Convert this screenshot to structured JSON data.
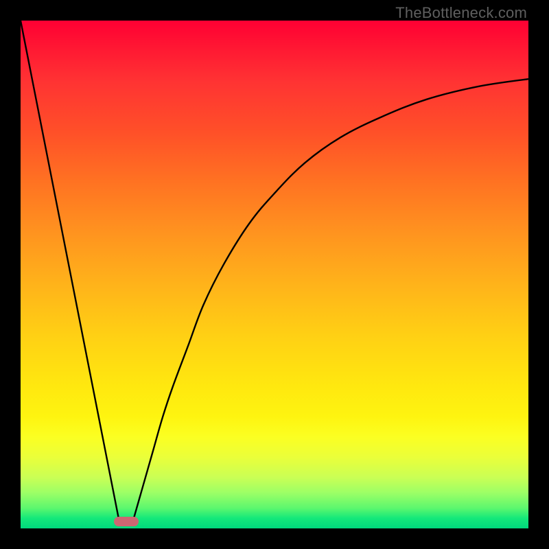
{
  "watermark": "TheBottleneck.com",
  "chart_data": {
    "type": "line",
    "title": "",
    "xlabel": "",
    "ylabel": "",
    "xlim": [
      0,
      100
    ],
    "ylim": [
      0,
      100
    ],
    "grid": false,
    "legend": false,
    "series": [
      {
        "name": "left-linear",
        "x": [
          0,
          19.5
        ],
        "y": [
          100,
          1
        ]
      },
      {
        "name": "right-curve",
        "x": [
          22,
          24,
          26,
          28,
          30,
          33,
          36,
          40,
          45,
          50,
          56,
          63,
          71,
          80,
          90,
          100
        ],
        "y": [
          1,
          8,
          15,
          22,
          28,
          36,
          44,
          52,
          60,
          66,
          72,
          77,
          81,
          84.5,
          87,
          88.5
        ]
      }
    ],
    "marker": {
      "x": 20.8,
      "cy": 1.3
    },
    "gradient_stops": [
      {
        "pos": 0,
        "color": "#ff0033"
      },
      {
        "pos": 50,
        "color": "#ffb31a"
      },
      {
        "pos": 80,
        "color": "#fef410"
      },
      {
        "pos": 100,
        "color": "#00d97d"
      }
    ]
  }
}
